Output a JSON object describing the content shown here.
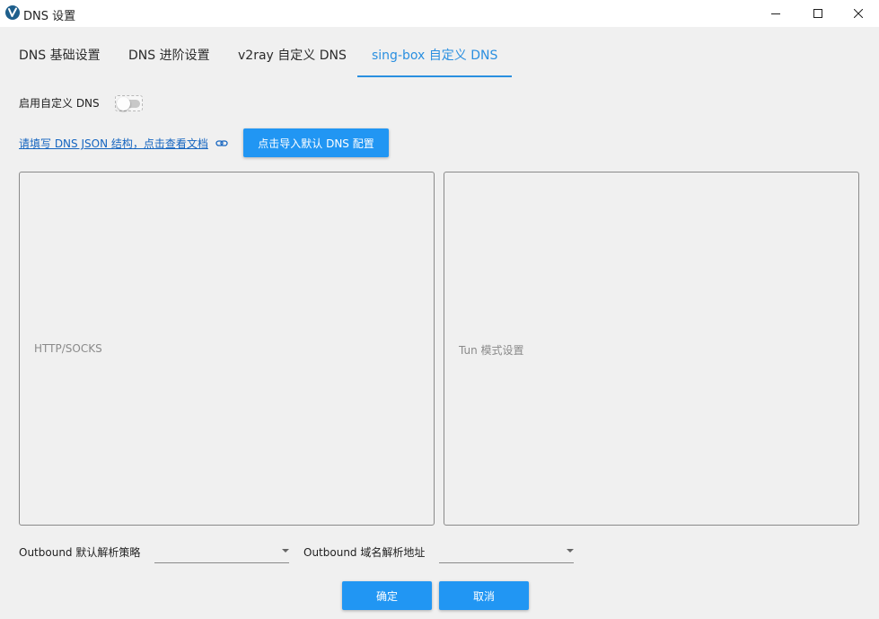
{
  "window": {
    "title": "DNS 设置",
    "icon": "v2rayn-logo-icon"
  },
  "window_controls": {
    "minimize": "minimize-icon",
    "maximize": "maximize-icon",
    "close": "close-icon"
  },
  "tabs": [
    {
      "label": "DNS 基础设置",
      "active": false
    },
    {
      "label": "DNS 进阶设置",
      "active": false
    },
    {
      "label": "v2ray 自定义 DNS",
      "active": false
    },
    {
      "label": "sing-box 自定义 DNS",
      "active": true
    }
  ],
  "custom_dns": {
    "toggle_label": "启用自定义 DNS",
    "enabled": false
  },
  "doc_link": {
    "text": "请填写 DNS JSON 结构，点击查看文档",
    "icon": "link-icon"
  },
  "import_button": {
    "label": "点击导入默认 DNS 配置"
  },
  "editors": {
    "left_placeholder": "HTTP/SOCKS",
    "right_placeholder": "Tun 模式设置"
  },
  "outbound_strategy": {
    "label": "Outbound 默认解析策略",
    "value": ""
  },
  "outbound_domain": {
    "label": "Outbound 域名解析地址",
    "value": ""
  },
  "dialog_buttons": {
    "ok": "确定",
    "cancel": "取消"
  },
  "colors": {
    "accent": "#2196f3",
    "tab_active": "#2a8fe0",
    "link": "#1565c0",
    "background": "#f0f0f0"
  }
}
